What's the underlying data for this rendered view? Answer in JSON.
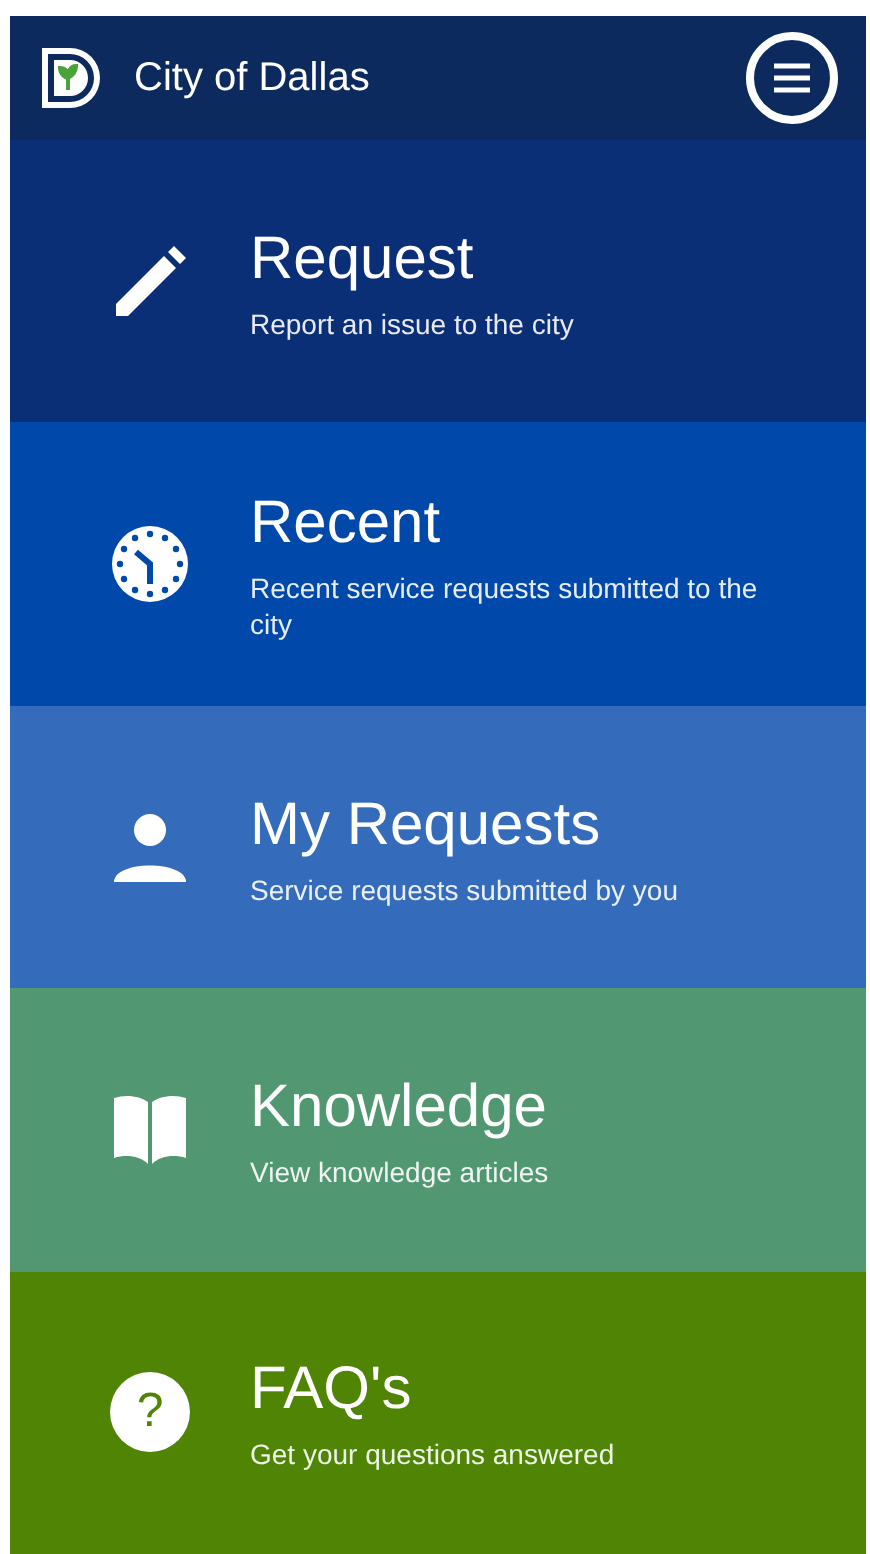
{
  "header": {
    "title": "City of Dallas"
  },
  "tiles": [
    {
      "kind": "pencil",
      "title": "Request",
      "subtitle": "Report an issue to the city",
      "color": "#0b2f76"
    },
    {
      "kind": "clock",
      "title": "Recent",
      "subtitle": "Recent service requests submitted to the city",
      "color": "#0048aa"
    },
    {
      "kind": "person",
      "title": "My Requests",
      "subtitle": "Service requests submitted by you",
      "color": "#346cbb"
    },
    {
      "kind": "book",
      "title": "Knowledge",
      "subtitle": "View knowledge articles",
      "color": "#519771"
    },
    {
      "kind": "question",
      "glyph": "?",
      "title": "FAQ's",
      "subtitle": "Get your questions answered",
      "color": "#4f8404"
    }
  ]
}
